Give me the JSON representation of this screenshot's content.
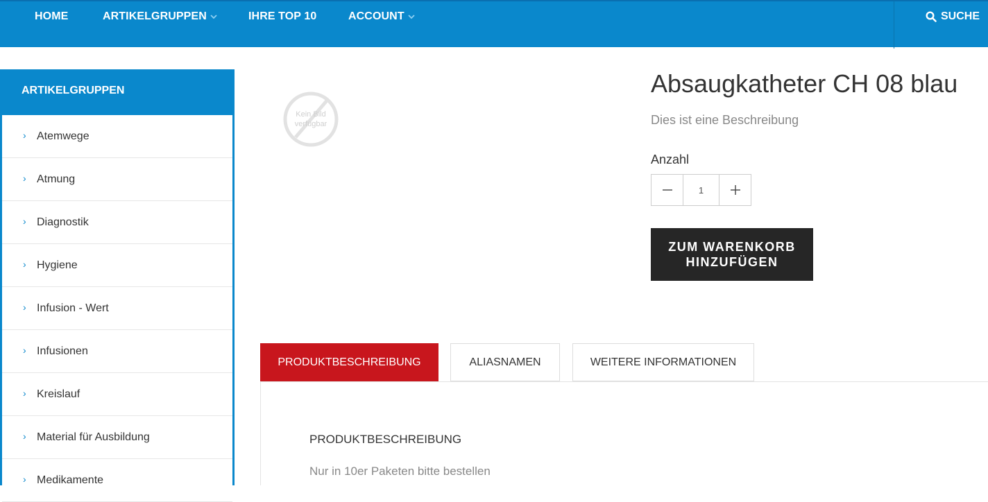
{
  "nav": {
    "items": [
      {
        "label": "HOME"
      },
      {
        "label": "ARTIKELGRUPPEN"
      },
      {
        "label": "IHRE TOP 10"
      },
      {
        "label": "ACCOUNT"
      }
    ],
    "search_label": "SUCHE"
  },
  "sidebar": {
    "title": "ARTIKELGRUPPEN",
    "items": [
      {
        "label": "Atemwege"
      },
      {
        "label": "Atmung"
      },
      {
        "label": "Diagnostik"
      },
      {
        "label": "Hygiene"
      },
      {
        "label": "Infusion - Wert"
      },
      {
        "label": "Infusionen"
      },
      {
        "label": "Kreislauf"
      },
      {
        "label": "Material für Ausbildung"
      },
      {
        "label": "Medikamente"
      }
    ]
  },
  "product": {
    "no_image_line1": "Kein Bild",
    "no_image_line2": "verfügbar",
    "title": "Absaugkatheter CH 08 blau",
    "description": "Dies ist eine Beschreibung",
    "quantity_label": "Anzahl",
    "quantity_value": "1",
    "decrement_symbol": "−",
    "increment_symbol": "+",
    "cart_button_line1": "ZUM WARENKORB",
    "cart_button_line2": "HINZUFÜGEN"
  },
  "tabs": {
    "items": [
      {
        "label": "PRODUKTBESCHREIBUNG"
      },
      {
        "label": "ALIASNAMEN"
      },
      {
        "label": "WEITERE INFORMATIONEN"
      }
    ],
    "panel_title": "PRODUKTBESCHREIBUNG",
    "panel_text": "Nur in 10er Paketen bitte bestellen"
  },
  "colors": {
    "nav_blue": "#0a88cc",
    "active_tab_red": "#c8161d",
    "cart_button": "#262626"
  }
}
